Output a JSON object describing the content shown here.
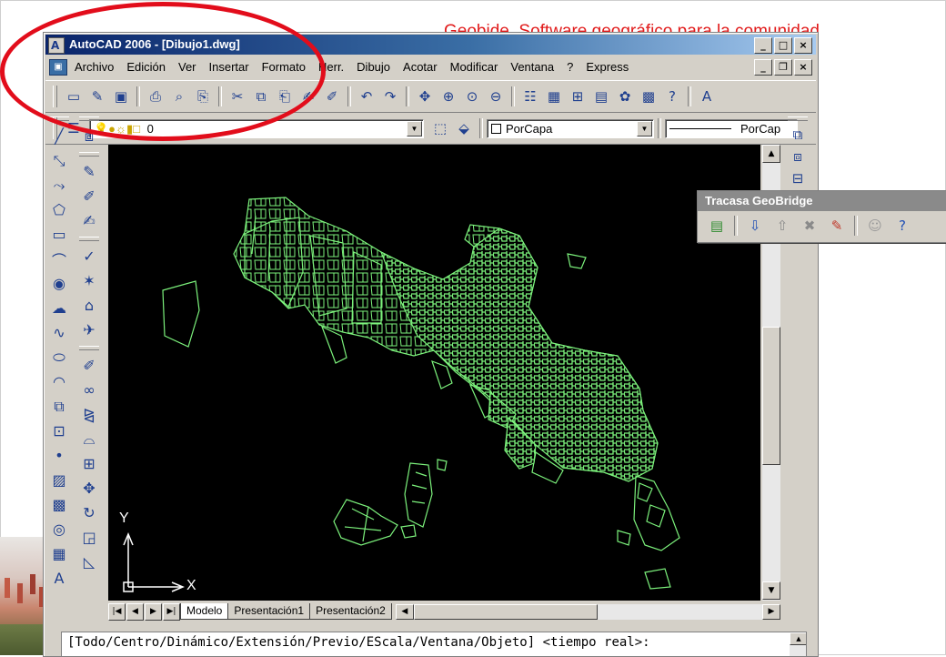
{
  "slide": {
    "title": "Geobide, Software geográfico para la comunidad"
  },
  "window": {
    "title": "AutoCAD 2006 - [Dibujo1.dwg]",
    "controls": {
      "minimize": "_",
      "maximize": "□",
      "close": "×",
      "restore": "❐"
    }
  },
  "menu": [
    "Archivo",
    "Edición",
    "Ver",
    "Insertar",
    "Formato",
    "Herr.",
    "Dibujo",
    "Acotar",
    "Modificar",
    "Ventana",
    "?",
    "Express"
  ],
  "toolbar": {
    "icons": [
      "new-icon",
      "open-icon",
      "save-icon",
      "plot-icon",
      "plot-preview-icon",
      "publish-icon",
      "cut-icon",
      "copy-icon",
      "paste-icon",
      "matchprop-icon",
      "block-edit-icon",
      "undo-icon",
      "redo-icon",
      "pan-icon",
      "zoom-realtime-icon",
      "zoom-window-icon",
      "zoom-previous-icon",
      "properties-icon",
      "design-center-icon",
      "tool-palettes-icon",
      "sheet-set-icon",
      "markup-icon",
      "calculator-icon",
      "help-icon",
      "text-style-icon"
    ],
    "glyphs": [
      "▭",
      "✎",
      "▣",
      "⎙",
      "⌕",
      "⎘",
      "✂",
      "⧉",
      "⎗",
      "✍",
      "✐",
      "↶",
      "↷",
      "✥",
      "⊕",
      "⊙",
      "⊖",
      "☷",
      "▦",
      "⊞",
      "▤",
      "✿",
      "▩",
      "?",
      "A"
    ]
  },
  "layer_bar": {
    "current_layer": "0",
    "layer_state_glyphs": "💡●☼▮□",
    "color_control": "PorCapa",
    "linetype_control": "PorCap"
  },
  "left_toolbar": {
    "draw": [
      {
        "name": "line-icon",
        "glyph": "╱"
      },
      {
        "name": "construction-line-icon",
        "glyph": "⤡"
      },
      {
        "name": "polyline-icon",
        "glyph": "⤳"
      },
      {
        "name": "polygon-icon",
        "glyph": "⬠"
      },
      {
        "name": "rectangle-icon",
        "glyph": "▭"
      },
      {
        "name": "arc-icon",
        "glyph": "⌒"
      },
      {
        "name": "circle-icon",
        "glyph": "◉"
      },
      {
        "name": "revision-cloud-icon",
        "glyph": "☁"
      },
      {
        "name": "spline-icon",
        "glyph": "∿"
      },
      {
        "name": "ellipse-icon",
        "glyph": "⬭"
      },
      {
        "name": "ellipse-arc-icon",
        "glyph": "◠"
      },
      {
        "name": "insert-block-icon",
        "glyph": "⧉"
      },
      {
        "name": "make-block-icon",
        "glyph": "⊡"
      },
      {
        "name": "point-icon",
        "glyph": "•"
      },
      {
        "name": "hatch-icon",
        "glyph": "▨"
      },
      {
        "name": "gradient-icon",
        "glyph": "▩"
      },
      {
        "name": "region-icon",
        "glyph": "◎"
      },
      {
        "name": "table-icon",
        "glyph": "▦"
      },
      {
        "name": "multiline-text-icon",
        "glyph": "A"
      }
    ],
    "modify_top": [
      {
        "name": "draworder-icon",
        "glyph": "⧈"
      }
    ],
    "modify_a": [
      {
        "name": "edit-icon",
        "glyph": "✎"
      },
      {
        "name": "edit-attribute-icon",
        "glyph": "✐"
      },
      {
        "name": "match-icon",
        "glyph": "✍"
      }
    ],
    "modify_b": [
      {
        "name": "dim-edit-icon",
        "glyph": "✓"
      },
      {
        "name": "dim-tedit-icon",
        "glyph": "✶"
      },
      {
        "name": "attdef-icon",
        "glyph": "⌂"
      },
      {
        "name": "refedit-icon",
        "glyph": "✈"
      }
    ],
    "modify_c": [
      {
        "name": "erase-icon",
        "glyph": "✐"
      },
      {
        "name": "copy-object-icon",
        "glyph": "∞"
      },
      {
        "name": "mirror-icon",
        "glyph": "⧎"
      },
      {
        "name": "offset-icon",
        "glyph": "⌓"
      },
      {
        "name": "array-icon",
        "glyph": "⊞"
      },
      {
        "name": "move-icon",
        "glyph": "✥"
      },
      {
        "name": "rotate-icon",
        "glyph": "↻"
      },
      {
        "name": "scale-icon",
        "glyph": "◲"
      },
      {
        "name": "stretch-icon",
        "glyph": "◺"
      }
    ]
  },
  "right_toolbar": [
    {
      "name": "layer-previous-icon",
      "glyph": "⧉"
    },
    {
      "name": "layer-isolate-icon",
      "glyph": "⧈"
    },
    {
      "name": "layer-walk-icon",
      "glyph": "⊟"
    },
    {
      "name": "layer-merge-icon",
      "glyph": "▣"
    }
  ],
  "ucs": {
    "y": "Y",
    "x": "X"
  },
  "tabs": [
    "Modelo",
    "Presentación1",
    "Presentación2"
  ],
  "tab_nav": [
    "|◀",
    "◀",
    "▶",
    "▶|"
  ],
  "command_line": "[Todo/Centro/Dinámico/Extensión/Previo/EScala/Ventana/Objeto] <tiempo real>:",
  "geobridge": {
    "title": "Tracasa GeoBridge",
    "tools": [
      {
        "name": "layers-icon",
        "glyph": "▤",
        "color": "#2e8b2e"
      },
      {
        "name": "download-icon",
        "glyph": "⇩",
        "color": "#1f4fb5"
      },
      {
        "name": "upload-icon",
        "glyph": "⇧",
        "color": "#8a8a8a"
      },
      {
        "name": "delete-icon",
        "glyph": "✖",
        "color": "#8a8a8a"
      },
      {
        "name": "edit-icon",
        "glyph": "✎",
        "color": "#c0392b"
      },
      {
        "name": "smiley-icon",
        "glyph": "☺",
        "color": "#9a9a9a"
      },
      {
        "name": "help-icon",
        "glyph": "?",
        "color": "#1f4fb5"
      }
    ]
  },
  "colors": {
    "drawing_bg": "#000000",
    "map_lines": "#7cf27c",
    "highlight": "#e20d1b",
    "title_red": "#e11b1b"
  }
}
